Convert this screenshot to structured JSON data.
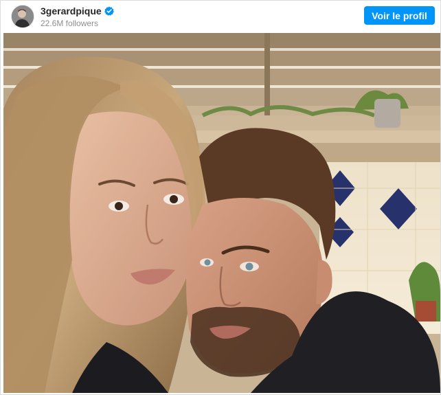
{
  "post": {
    "username": "3gerardpique",
    "followers": "22.6M followers",
    "profile_button": "Voir le profil",
    "accent_color": "#0095f6",
    "verified_icon": "verified-badge-icon"
  }
}
